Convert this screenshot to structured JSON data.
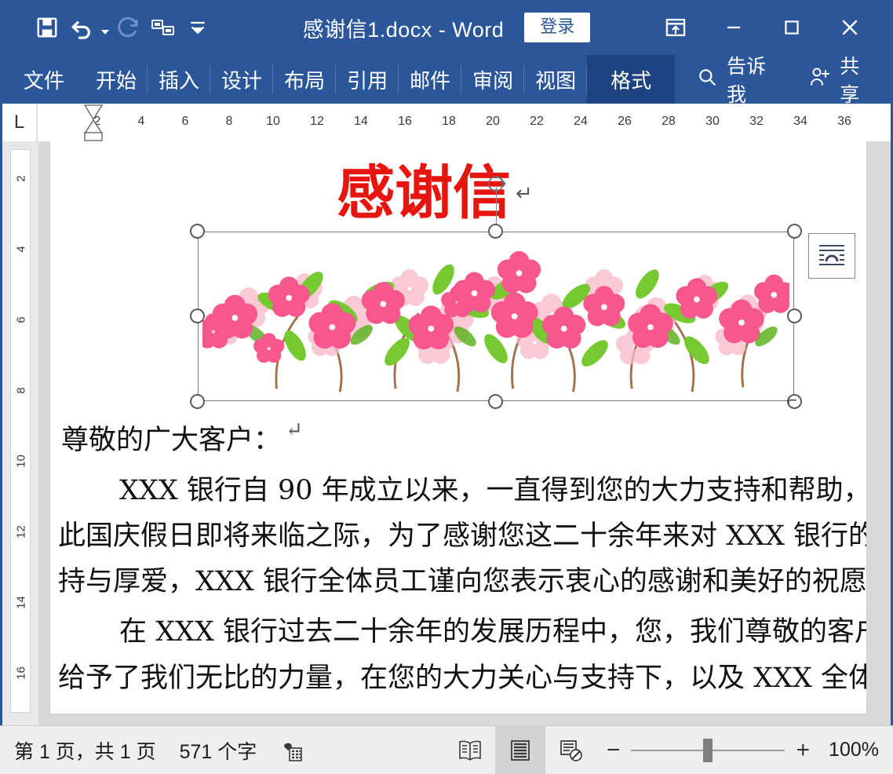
{
  "titlebar": {
    "document_title": "感谢信1.docx  -  Word",
    "signin_label": "登录",
    "quick_access": [
      {
        "name": "save-icon",
        "label": "保存"
      },
      {
        "name": "undo-icon",
        "label": "撤消"
      },
      {
        "name": "redo-icon",
        "label": "恢复"
      },
      {
        "name": "touch-mouse-mode-icon",
        "label": "触摸/鼠标模式"
      },
      {
        "name": "customize-qat-icon",
        "label": "自定义快速访问工具栏"
      }
    ],
    "window_controls": [
      {
        "name": "ribbon-display-options-icon",
        "label": "功能区显示选项"
      },
      {
        "name": "minimize-icon",
        "label": "最小化"
      },
      {
        "name": "maximize-icon",
        "label": "最大化"
      },
      {
        "name": "close-icon",
        "label": "关闭"
      }
    ]
  },
  "ribbon": {
    "tabs": [
      {
        "label": "文件",
        "active": false
      },
      {
        "label": "开始",
        "active": false
      },
      {
        "label": "插入",
        "active": false
      },
      {
        "label": "设计",
        "active": false
      },
      {
        "label": "布局",
        "active": false
      },
      {
        "label": "引用",
        "active": false
      },
      {
        "label": "邮件",
        "active": false
      },
      {
        "label": "审阅",
        "active": false
      },
      {
        "label": "视图",
        "active": false
      },
      {
        "label": "格式",
        "active": true
      }
    ],
    "tell_me": "告诉我",
    "share": "共享",
    "accent_color": "#2b579a",
    "active_tab_color": "#1f4280"
  },
  "ruler": {
    "tab_stop_selector": "L",
    "horizontal_ticks": [
      "2",
      "4",
      "6",
      "8",
      "10",
      "12",
      "14",
      "16",
      "18",
      "20",
      "22",
      "24",
      "26",
      "28",
      "30",
      "32",
      "34",
      "36"
    ],
    "vertical_ticks": [
      "2",
      "4",
      "6",
      "8",
      "10",
      "12",
      "14",
      "16"
    ]
  },
  "document": {
    "heading": "感谢信",
    "heading_color": "#e8140f",
    "paragraph_mark": "↵",
    "salutation": "尊敬的广大客户：",
    "paragraphs": [
      "XXX 银行自 90 年成立以来，一直得到您的大力支持和帮助，",
      "此国庆假日即将来临之际，为了感谢您这二十余年来对 XXX 银行的支",
      "持与厚爱，XXX 银行全体员工谨向您表示衷心的感谢和美好的祝愿",
      "在 XXX 银行过去二十余年的发展历程中，您，我们尊敬的客户，",
      "给予了我们无比的力量，在您的大力关心与支持下，以及 XXX 全体"
    ],
    "image": {
      "name": "flower-border-picture",
      "alt": "粉色花朵边框图片",
      "selected": true,
      "handle_count": 8,
      "rotation_handle": true,
      "layout_options_label": "布局选项"
    }
  },
  "statusbar": {
    "page_info": "第 1 页，共 1 页",
    "word_count": "571 个字",
    "proofing_icon": "proofing-status-icon",
    "views": [
      {
        "name": "read-mode-view-icon",
        "label": "阅读视图",
        "active": false
      },
      {
        "name": "print-layout-view-icon",
        "label": "页面视图",
        "active": true
      },
      {
        "name": "web-layout-view-icon",
        "label": "Web 版式视图",
        "active": false
      }
    ],
    "zoom_out_label": "−",
    "zoom_in_label": "+",
    "zoom_level": "100%"
  }
}
